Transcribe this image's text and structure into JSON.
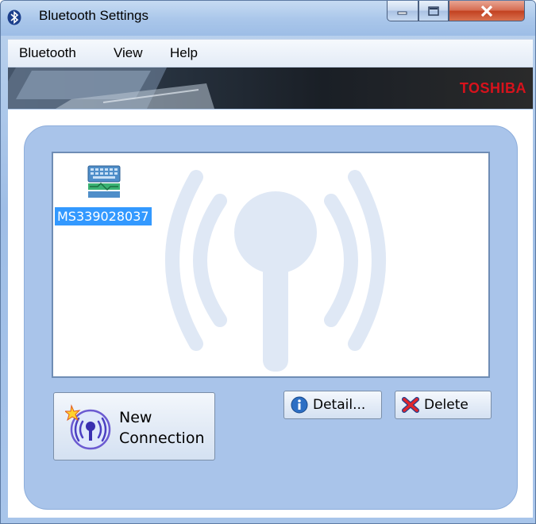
{
  "window": {
    "title": "Bluetooth Settings",
    "controls": [
      "minimize-icon",
      "maximize-icon",
      "close-icon"
    ]
  },
  "menu": {
    "items": [
      "Bluetooth",
      "View",
      "Help"
    ]
  },
  "banner": {
    "brand": "TOSHIBA",
    "brand_color": "#d8121c"
  },
  "devices": [
    {
      "name": "MS339028037",
      "icon": "keyboard-icon",
      "selected": true
    }
  ],
  "buttons": {
    "new_connection_line1": "New",
    "new_connection_line2": "Connection",
    "detail": "Detail...",
    "delete": "Delete"
  },
  "colors": {
    "panel": "#a9c4ea",
    "selection": "#3399ff"
  }
}
